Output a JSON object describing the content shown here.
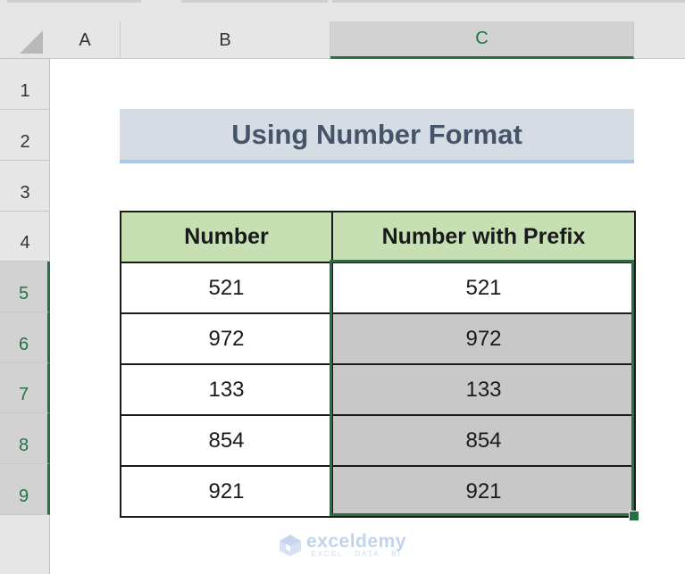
{
  "sheet": {
    "columns": [
      "A",
      "B",
      "C"
    ],
    "selected_column": "C",
    "rows": [
      "1",
      "2",
      "3",
      "4",
      "5",
      "6",
      "7",
      "8",
      "9"
    ],
    "selected_rows": [
      "5",
      "6",
      "7",
      "8",
      "9"
    ]
  },
  "title": "Using Number Format",
  "table": {
    "headers": [
      "Number",
      "Number with Prefix"
    ],
    "rows": [
      [
        "521",
        "521"
      ],
      [
        "972",
        "972"
      ],
      [
        "133",
        "133"
      ],
      [
        "854",
        "854"
      ],
      [
        "921",
        "921"
      ]
    ]
  },
  "watermark": {
    "brand": "exceldemy",
    "tagline": "EXCEL · DATA · BI"
  },
  "colors": {
    "selection": "#217346",
    "header_fill": "#c6e0b4",
    "title_fill": "#d6dce4",
    "title_text": "#44546a",
    "selected_cell_fill": "#c8c8c8"
  }
}
